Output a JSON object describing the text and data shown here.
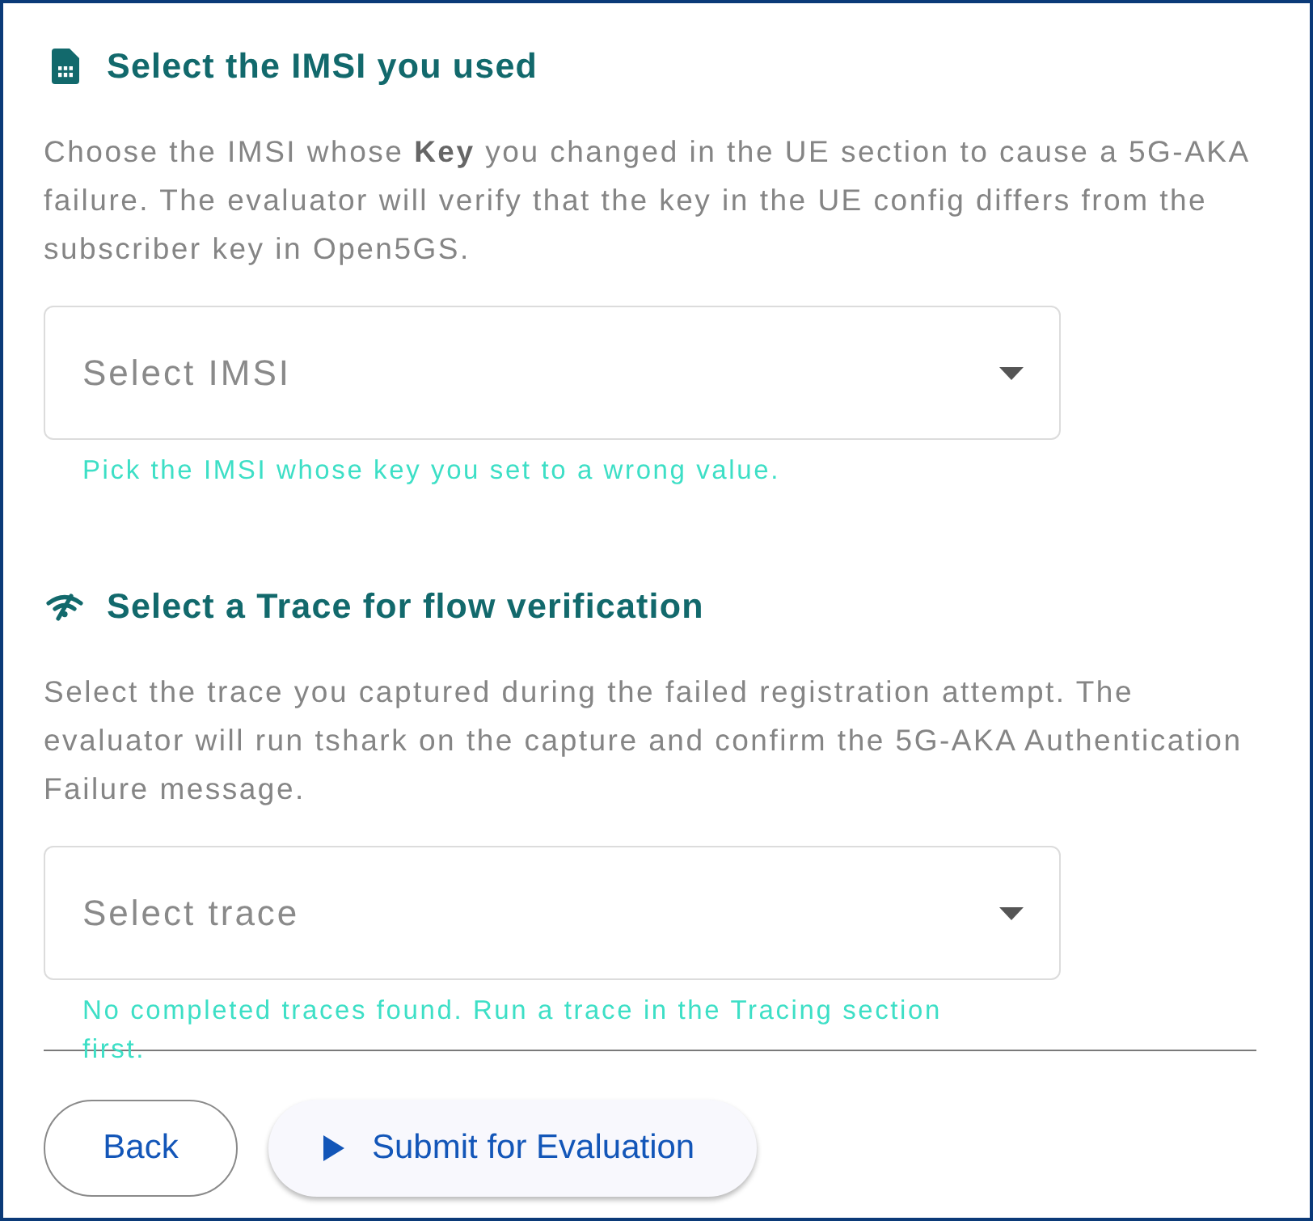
{
  "sections": [
    {
      "kind": "imsi",
      "title": "Select the IMSI you used",
      "description": "Choose the IMSI whose **Key** you changed in the UE section to cause a 5G-AKA failure. The evaluator will verify that the key in the UE config differs from the subscriber key in Open5GS.",
      "select": {
        "placeholder": "Select IMSI"
      },
      "helper": "Pick the IMSI whose key you set to a wrong value."
    },
    {
      "kind": "trace",
      "title": "Select a Trace for flow verification",
      "description": "Select the trace you captured during the failed registration attempt. The evaluator will run tshark on the capture and confirm the 5G-AKA Authentication Failure message.",
      "select": {
        "placeholder": "Select trace"
      },
      "helper": "No completed traces found. Run a trace in the Tracing section first."
    }
  ],
  "buttons": [
    {
      "kind": "outlined",
      "label": "Back"
    },
    {
      "kind": "filled",
      "label": "Submit for Evaluation"
    }
  ]
}
